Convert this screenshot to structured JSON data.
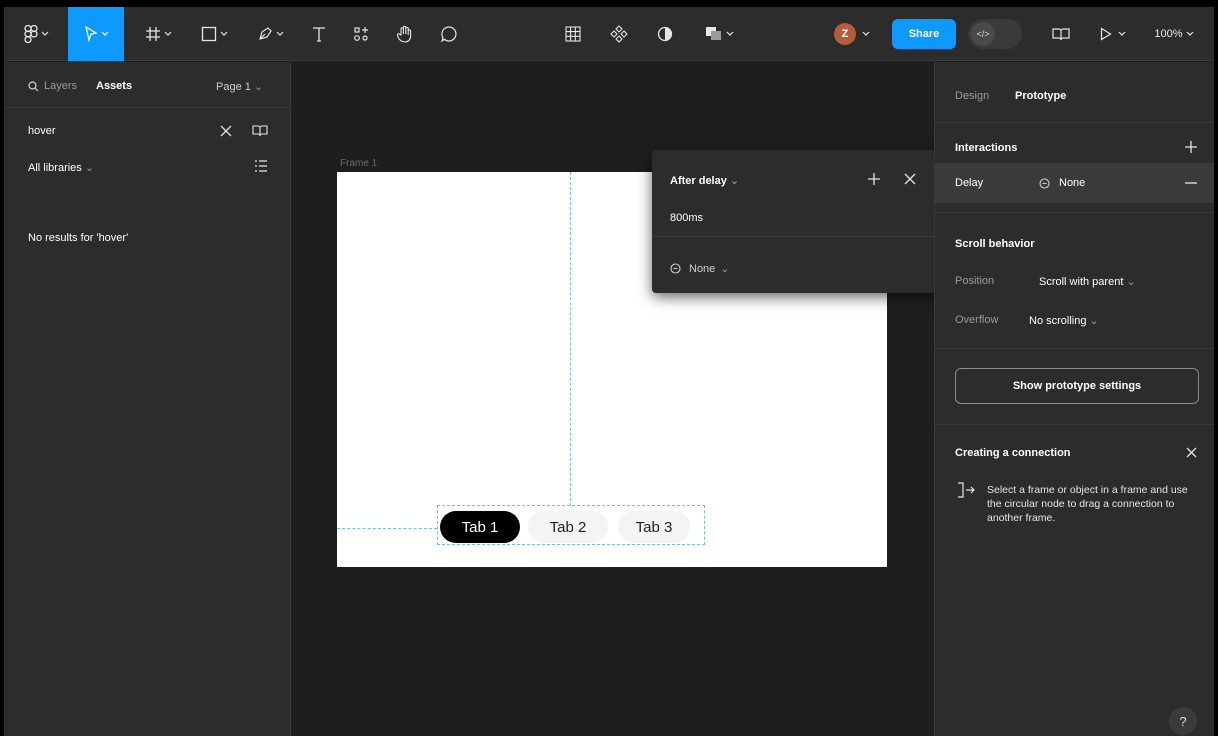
{
  "toolbar": {
    "share_label": "Share",
    "avatar_initial": "Z",
    "zoom_label": "100%"
  },
  "left_panel": {
    "tabs": {
      "layers": "Layers",
      "assets": "Assets",
      "page": "Page 1"
    },
    "search_value": "hover",
    "libraries_label": "All libraries",
    "empty_message": "No results for 'hover'"
  },
  "canvas": {
    "frame_label": "Frame 1",
    "tabs": [
      "Tab 1",
      "Tab 2",
      "Tab 3"
    ]
  },
  "popover": {
    "trigger": "After delay",
    "delay_value": "800ms",
    "action": "None"
  },
  "right_panel": {
    "tabs": {
      "design": "Design",
      "prototype": "Prototype"
    },
    "interactions": {
      "title": "Interactions",
      "trigger": "Delay",
      "action": "None"
    },
    "scroll": {
      "title": "Scroll behavior",
      "position_label": "Position",
      "position_value": "Scroll with parent",
      "overflow_label": "Overflow",
      "overflow_value": "No scrolling"
    },
    "settings_button": "Show prototype settings",
    "connection": {
      "title": "Creating a connection",
      "body": "Select a frame or object in a frame and use the circular node to drag a connection to another frame."
    },
    "help": "?"
  },
  "colors": {
    "accent": "#0d99ff",
    "panel": "#2c2c2c",
    "canvas": "#1e1e1e",
    "avatar": "#b45d3d"
  }
}
